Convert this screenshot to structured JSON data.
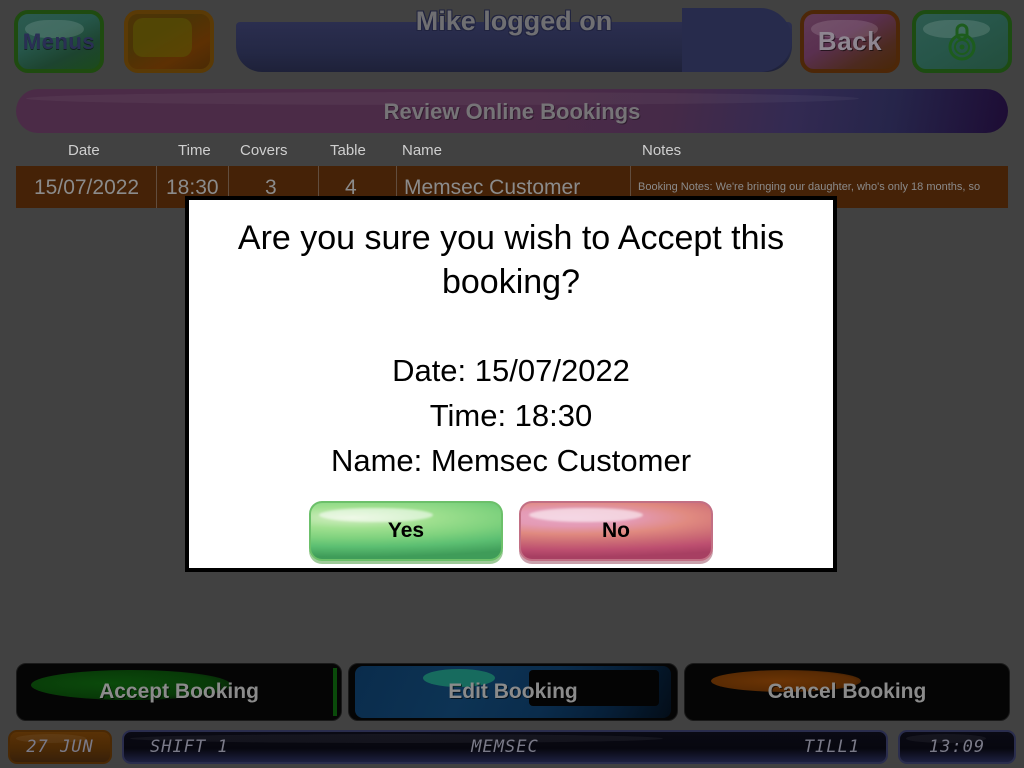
{
  "toolbar": {
    "menus_label": "Menus",
    "blank_label": "",
    "back_label": "Back",
    "lock_icon": "padlock-icon"
  },
  "header": {
    "title": "Mike logged on",
    "banner": "Review Online Bookings"
  },
  "table": {
    "columns": [
      "Date",
      "Time",
      "Covers",
      "Table",
      "Name",
      "Notes"
    ],
    "rows": [
      {
        "date": "15/07/2022",
        "time": "18:30",
        "covers": "3",
        "table": "4",
        "name": "Memsec Customer",
        "notes": "Booking Notes: We're bringing our daughter, who's only 18 months, so"
      }
    ]
  },
  "actions": {
    "accept_label": "Accept Booking",
    "edit_label": "Edit Booking",
    "cancel_label": "Cancel Booking"
  },
  "dialog": {
    "question": "Are you sure you wish to Accept this booking?",
    "date_line": "Date: 15/07/2022",
    "time_line": "Time: 18:30",
    "name_line": "Name: Memsec Customer",
    "yes_label": "Yes",
    "no_label": "No"
  },
  "statusbar": {
    "date": "27 JUN",
    "shift": "SHIFT 1",
    "site": "MEMSEC",
    "till": "TILL1",
    "time": "13:09"
  },
  "colors": {
    "page_background": "#414141",
    "row_highlight": "#452207",
    "banner_start": "#4b2b47",
    "banner_end": "#1d0c34",
    "titlebar": "#2b2e4f",
    "yes_button": "#7fd27e",
    "no_button": "#cd6d76"
  }
}
